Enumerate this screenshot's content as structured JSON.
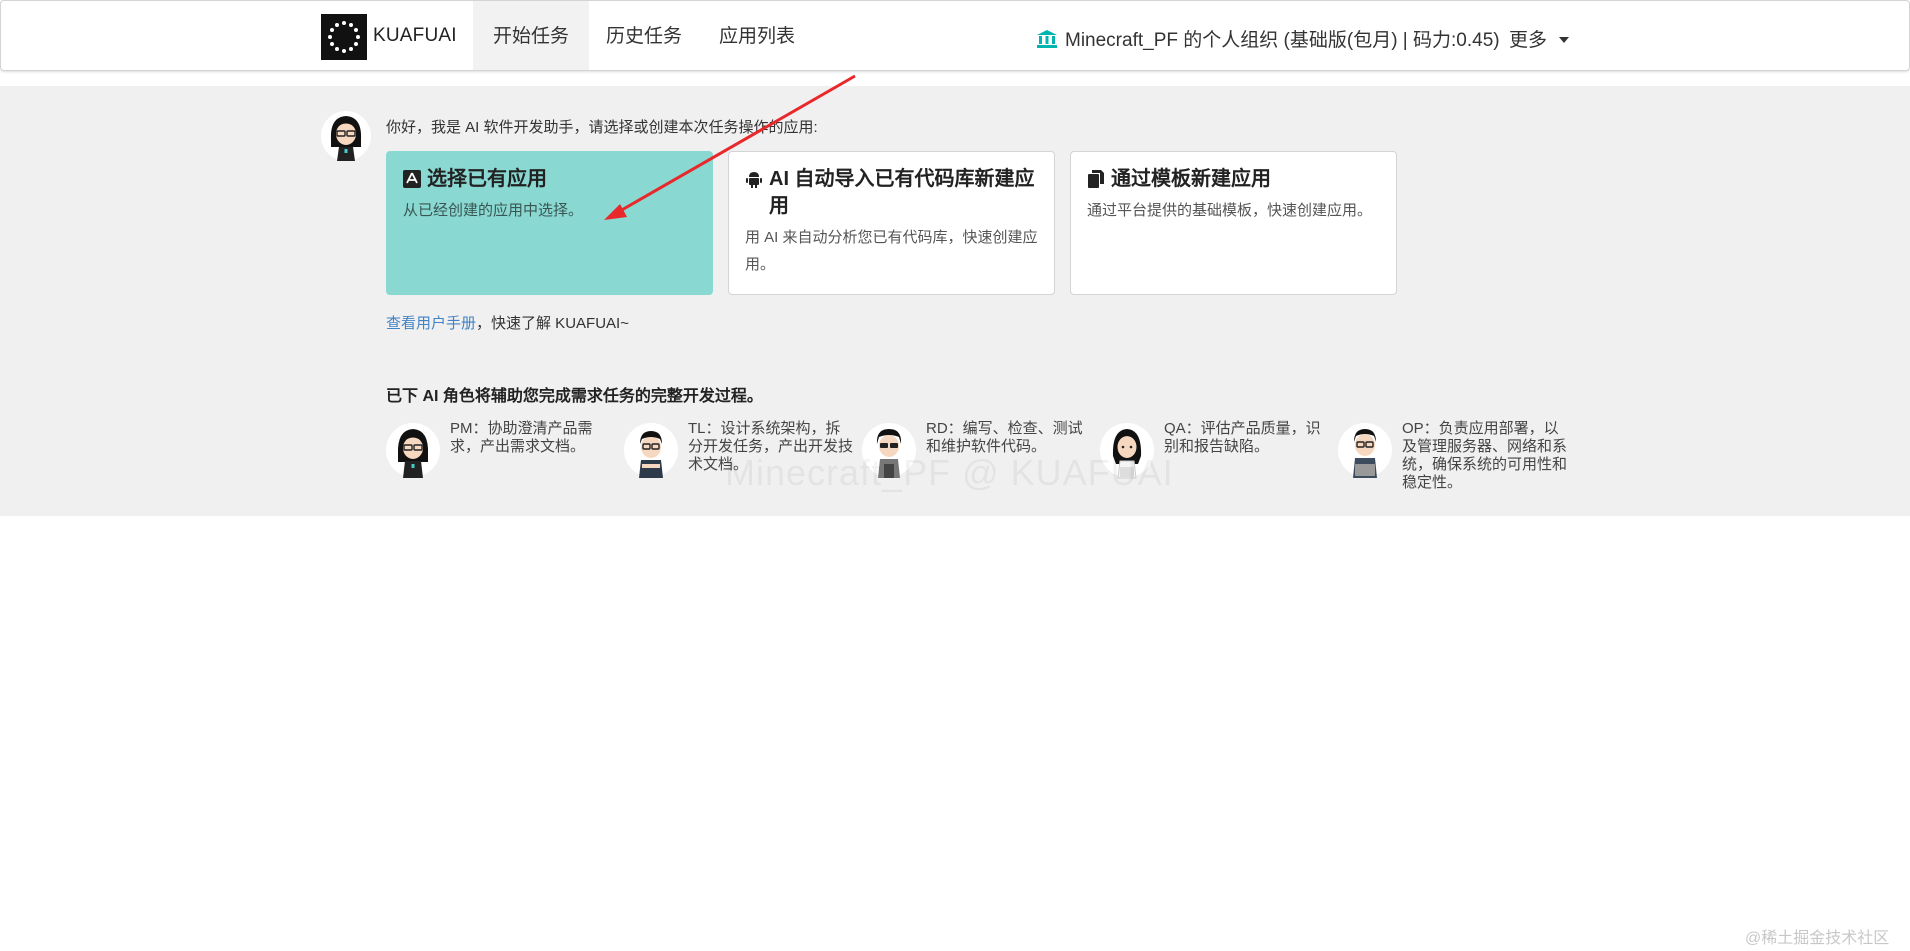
{
  "header": {
    "brand": "KUAFUAI",
    "tabs": [
      {
        "label": "开始任务",
        "active": true
      },
      {
        "label": "历史任务",
        "active": false
      },
      {
        "label": "应用列表",
        "active": false
      }
    ],
    "org_label": "Minecraft_PF 的个人组织 (基础版(包月) | 码力:0.45)",
    "more_label": "更多"
  },
  "assistant": {
    "greeting": "你好，我是 AI 软件开发助手，请选择或创建本次任务操作的应用:"
  },
  "cards": [
    {
      "title": "选择已有应用",
      "desc": "从已经创建的应用中选择。",
      "icon": "app-store-icon",
      "selected": true
    },
    {
      "title": "AI 自动导入已有代码库新建应用",
      "desc": "用 AI 来自动分析您已有代码库，快速创建应用。",
      "icon": "android-icon",
      "selected": false
    },
    {
      "title": "通过模板新建应用",
      "desc": "通过平台提供的基础模板，快速创建应用。",
      "icon": "copy-icon",
      "selected": false
    }
  ],
  "manual": {
    "link": "查看用户手册",
    "suffix": "，快速了解 KUAFUAI~"
  },
  "roles_title": "已下 AI 角色将辅助您完成需求任务的完整开发过程。",
  "roles": [
    {
      "text": "PM：协助澄清产品需求，产出需求文档。",
      "hair": "#111",
      "shirt": "#222"
    },
    {
      "text": "TL：设计系统架构，拆分开发任务，产出开发技术文档。",
      "hair": "#111",
      "shirt": "#2d3a4a"
    },
    {
      "text": "RD：编写、检查、测试和维护软件代码。",
      "hair": "#111",
      "shirt": "#666"
    },
    {
      "text": "QA：评估产品质量，识别和报告缺陷。",
      "hair": "#111",
      "shirt": "#f5f5f5"
    },
    {
      "text": "OP：负责应用部署，以及管理服务器、网络和系统，确保系统的可用性和稳定性。",
      "hair": "#111",
      "shirt": "#3c4c5e"
    }
  ],
  "watermark": "Minecraft_PF @ KUAFUAI",
  "corner_watermark": "@稀土掘金技术社区",
  "colors": {
    "selected_card": "#8ad8d2",
    "link": "#4183c4",
    "panel_bg": "#f0f0f0",
    "org_icon": "#00b5ad",
    "arrow": "#e8282a"
  }
}
